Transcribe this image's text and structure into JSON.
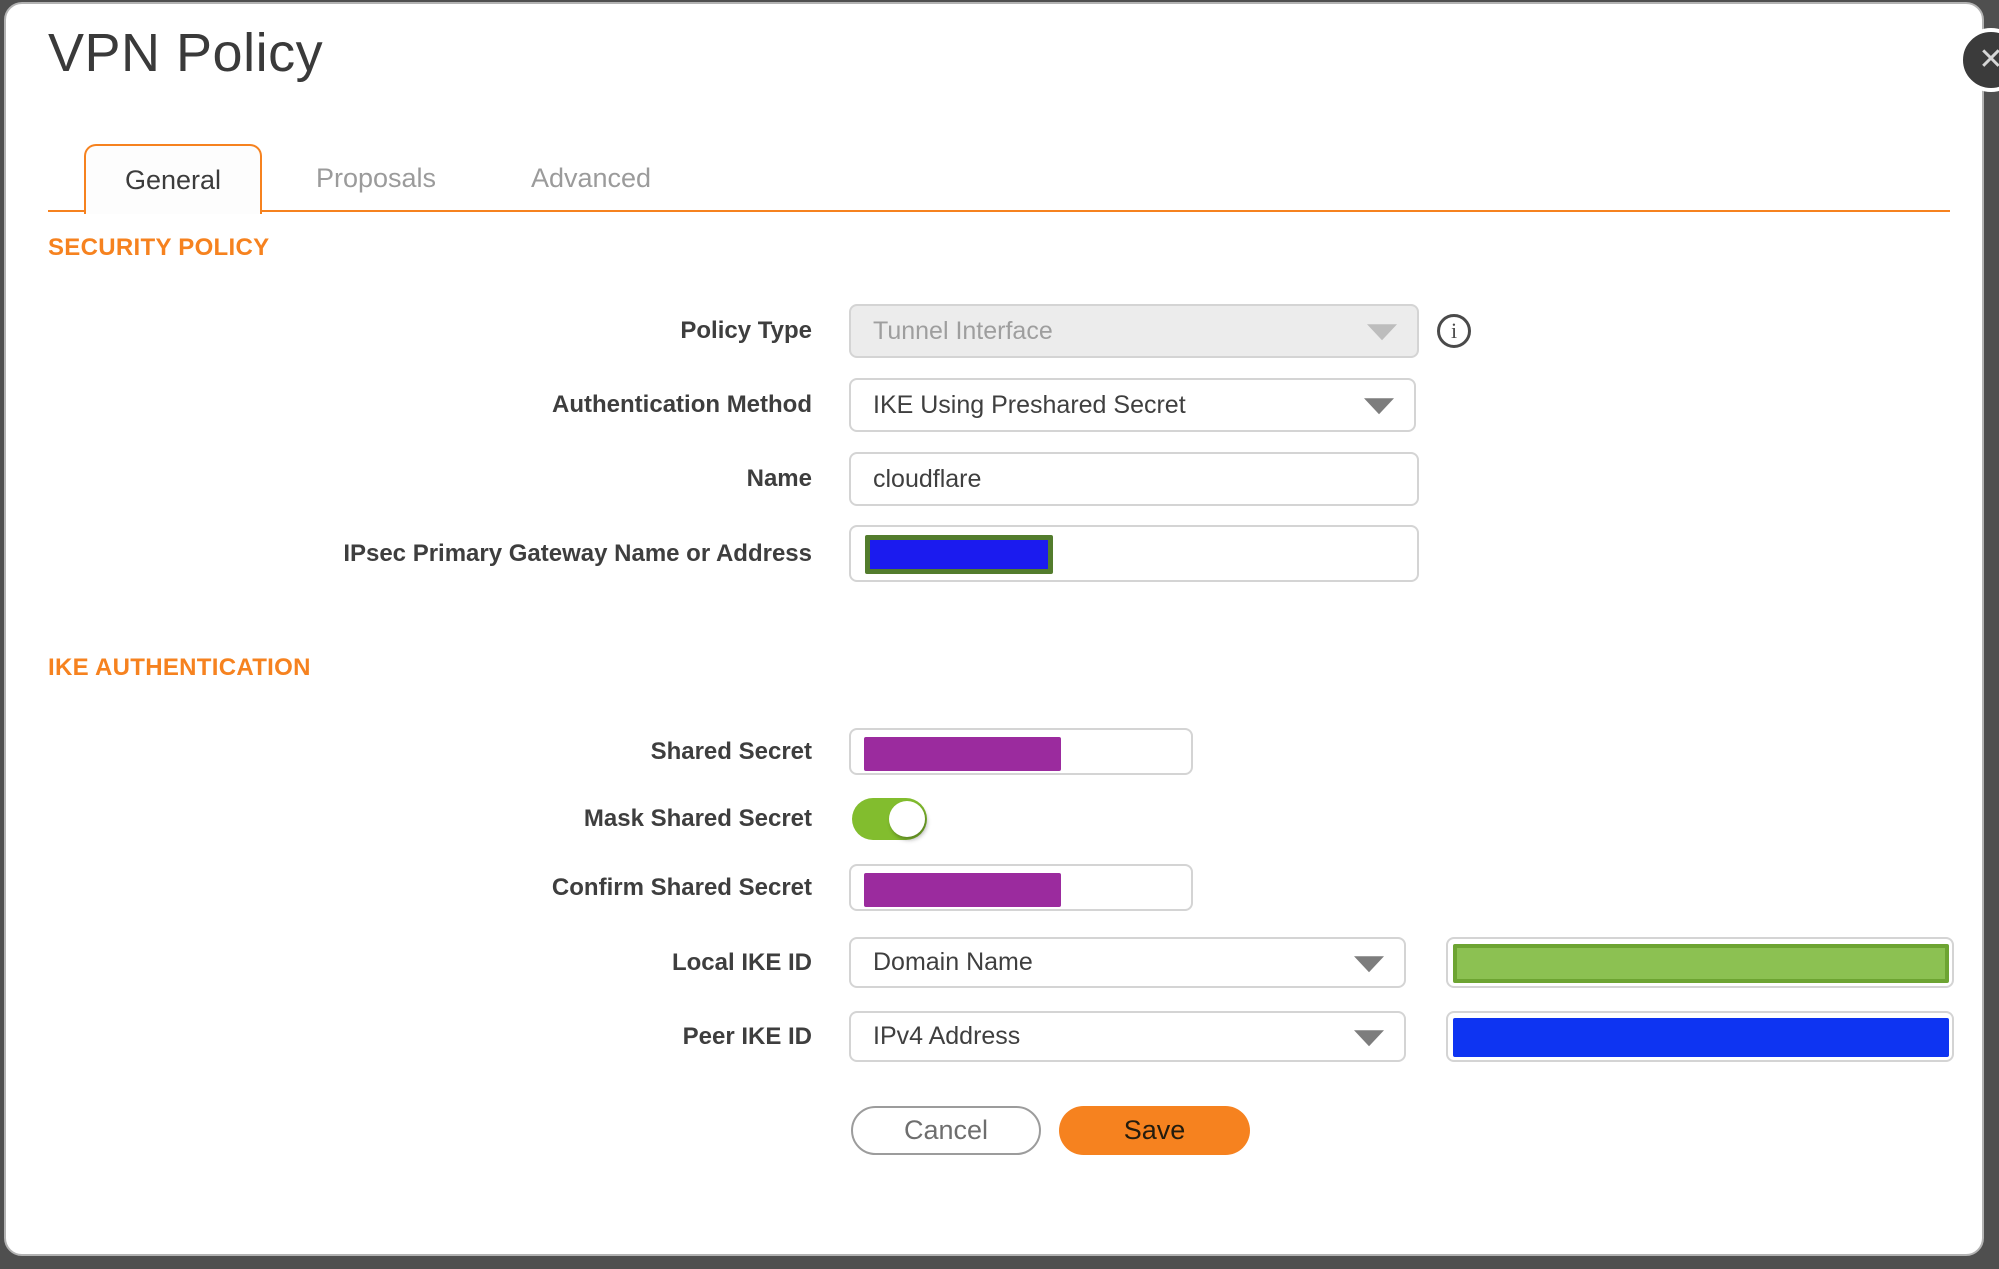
{
  "dialog": {
    "title": "VPN Policy",
    "close_icon": "✕",
    "info_icon": "i",
    "tabs": [
      {
        "label": "General",
        "active": true
      },
      {
        "label": "Proposals",
        "active": false
      },
      {
        "label": "Advanced",
        "active": false
      }
    ],
    "sections": {
      "security_policy": "SECURITY POLICY",
      "ike_authentication": "IKE AUTHENTICATION"
    },
    "fields": {
      "policy_type": {
        "label": "Policy Type",
        "value": "Tunnel Interface",
        "disabled": true
      },
      "authentication_method": {
        "label": "Authentication Method",
        "value": "IKE Using Preshared Secret"
      },
      "name": {
        "label": "Name",
        "value": "cloudflare"
      },
      "ipsec_gateway": {
        "label": "IPsec Primary Gateway Name or Address",
        "value": "",
        "redaction_fill": "#1b1bef",
        "redaction_border": "#537c2d"
      },
      "shared_secret": {
        "label": "Shared Secret",
        "value": "",
        "redaction_fill": "#9b2b9e"
      },
      "mask_shared_secret": {
        "label": "Mask Shared Secret",
        "state": "on"
      },
      "confirm_shared_secret": {
        "label": "Confirm Shared Secret",
        "value": "",
        "redaction_fill": "#9b2b9e"
      },
      "local_ike_id": {
        "label": "Local IKE ID",
        "value": "Domain Name",
        "redaction_fill": "#8cc152",
        "redaction_border": "#6da432"
      },
      "peer_ike_id": {
        "label": "Peer IKE ID",
        "value": "IPv4 Address",
        "redaction_fill": "#0e34f2"
      }
    },
    "buttons": {
      "cancel": "Cancel",
      "save": "Save"
    },
    "colors": {
      "accent": "#f6821f",
      "toggle_on": "#82bd2e",
      "backdrop": "#4f4f4f",
      "purple_redaction": "#9b2b9e",
      "blue_redaction": "#0e34f2",
      "green_redaction": "#8cc152"
    }
  }
}
